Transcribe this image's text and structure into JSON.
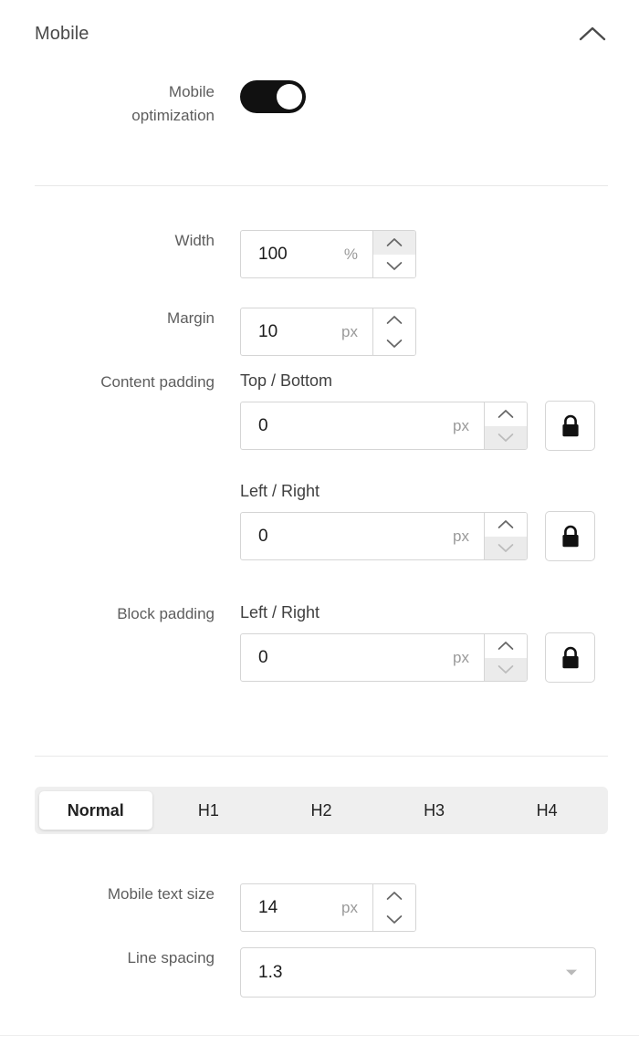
{
  "section": {
    "title": "Mobile",
    "collapse_icon": "chevron-up-icon"
  },
  "mobile_optimization": {
    "label_line1": "Mobile",
    "label_line2": "optimization",
    "state": "on"
  },
  "width": {
    "label": "Width",
    "value": "100",
    "unit": "%"
  },
  "margin": {
    "label": "Margin",
    "value": "10",
    "unit": "px"
  },
  "content_padding": {
    "label": "Content padding",
    "top_bottom": {
      "sub_label": "Top / Bottom",
      "value": "0",
      "unit": "px",
      "lock_icon": "lock-closed-icon"
    },
    "left_right": {
      "sub_label": "Left / Right",
      "value": "0",
      "unit": "px",
      "lock_icon": "lock-closed-icon"
    }
  },
  "block_padding": {
    "label": "Block padding",
    "left_right": {
      "sub_label": "Left / Right",
      "value": "0",
      "unit": "px",
      "lock_icon": "lock-closed-icon"
    }
  },
  "text_style_tabs": {
    "items": [
      {
        "label": "Normal",
        "active": true
      },
      {
        "label": "H1",
        "active": false
      },
      {
        "label": "H2",
        "active": false
      },
      {
        "label": "H3",
        "active": false
      },
      {
        "label": "H4",
        "active": false
      }
    ]
  },
  "mobile_text_size": {
    "label": "Mobile text size",
    "value": "14",
    "unit": "px"
  },
  "line_spacing": {
    "label": "Line spacing",
    "value": "1.3",
    "caret_icon": "caret-down-icon"
  },
  "colors": {
    "toggle_on": "#111111",
    "border": "#d5d5d5",
    "divider": "#e8e8e8",
    "tabbar_bg": "#efefef",
    "label_text": "#5d5d5d",
    "value_text": "#1c1c1c",
    "unit_text": "#9a9a9a"
  }
}
